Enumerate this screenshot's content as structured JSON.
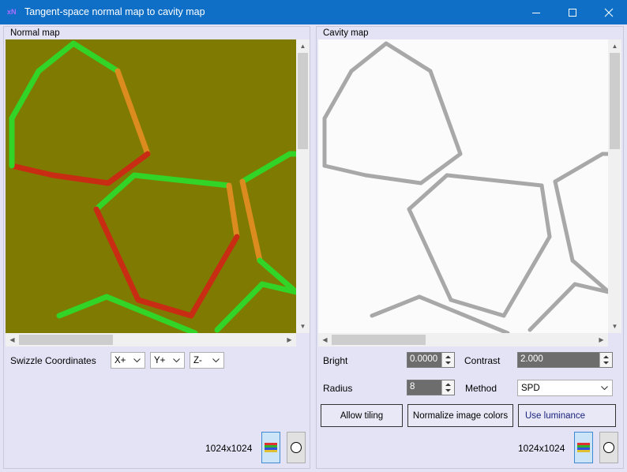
{
  "window": {
    "app_icon_text": "xN",
    "title": "Tangent-space normal map to cavity map",
    "minimize_glyph": "minimize-icon",
    "maximize_glyph": "maximize-icon",
    "close_glyph": "close-icon"
  },
  "left_panel": {
    "label": "Normal map",
    "swizzle_label": "Swizzle Coordinates",
    "swizzle": [
      {
        "value": "X+"
      },
      {
        "value": "Y+"
      },
      {
        "value": "Z-"
      }
    ],
    "size_text": "1024x1024",
    "colors": {
      "background": "#7f7a02",
      "edge_green": "#32d428",
      "edge_red": "#c82d14",
      "edge_orange": "#dc8c1e"
    }
  },
  "right_panel": {
    "label": "Cavity map",
    "bright": {
      "label": "Bright",
      "value": "0.0000"
    },
    "contrast": {
      "label": "Contrast",
      "value": "2.000"
    },
    "radius": {
      "label": "Radius",
      "value": "8"
    },
    "method": {
      "label": "Method",
      "value": "SPD"
    },
    "buttons": {
      "allow_tiling": "Allow tiling",
      "normalize": "Normalize image colors",
      "use_luminance": "Use luminance"
    },
    "size_text": "1024x1024",
    "colors": {
      "background": "#fbfbfb",
      "edge": "#a8a8a8"
    }
  }
}
